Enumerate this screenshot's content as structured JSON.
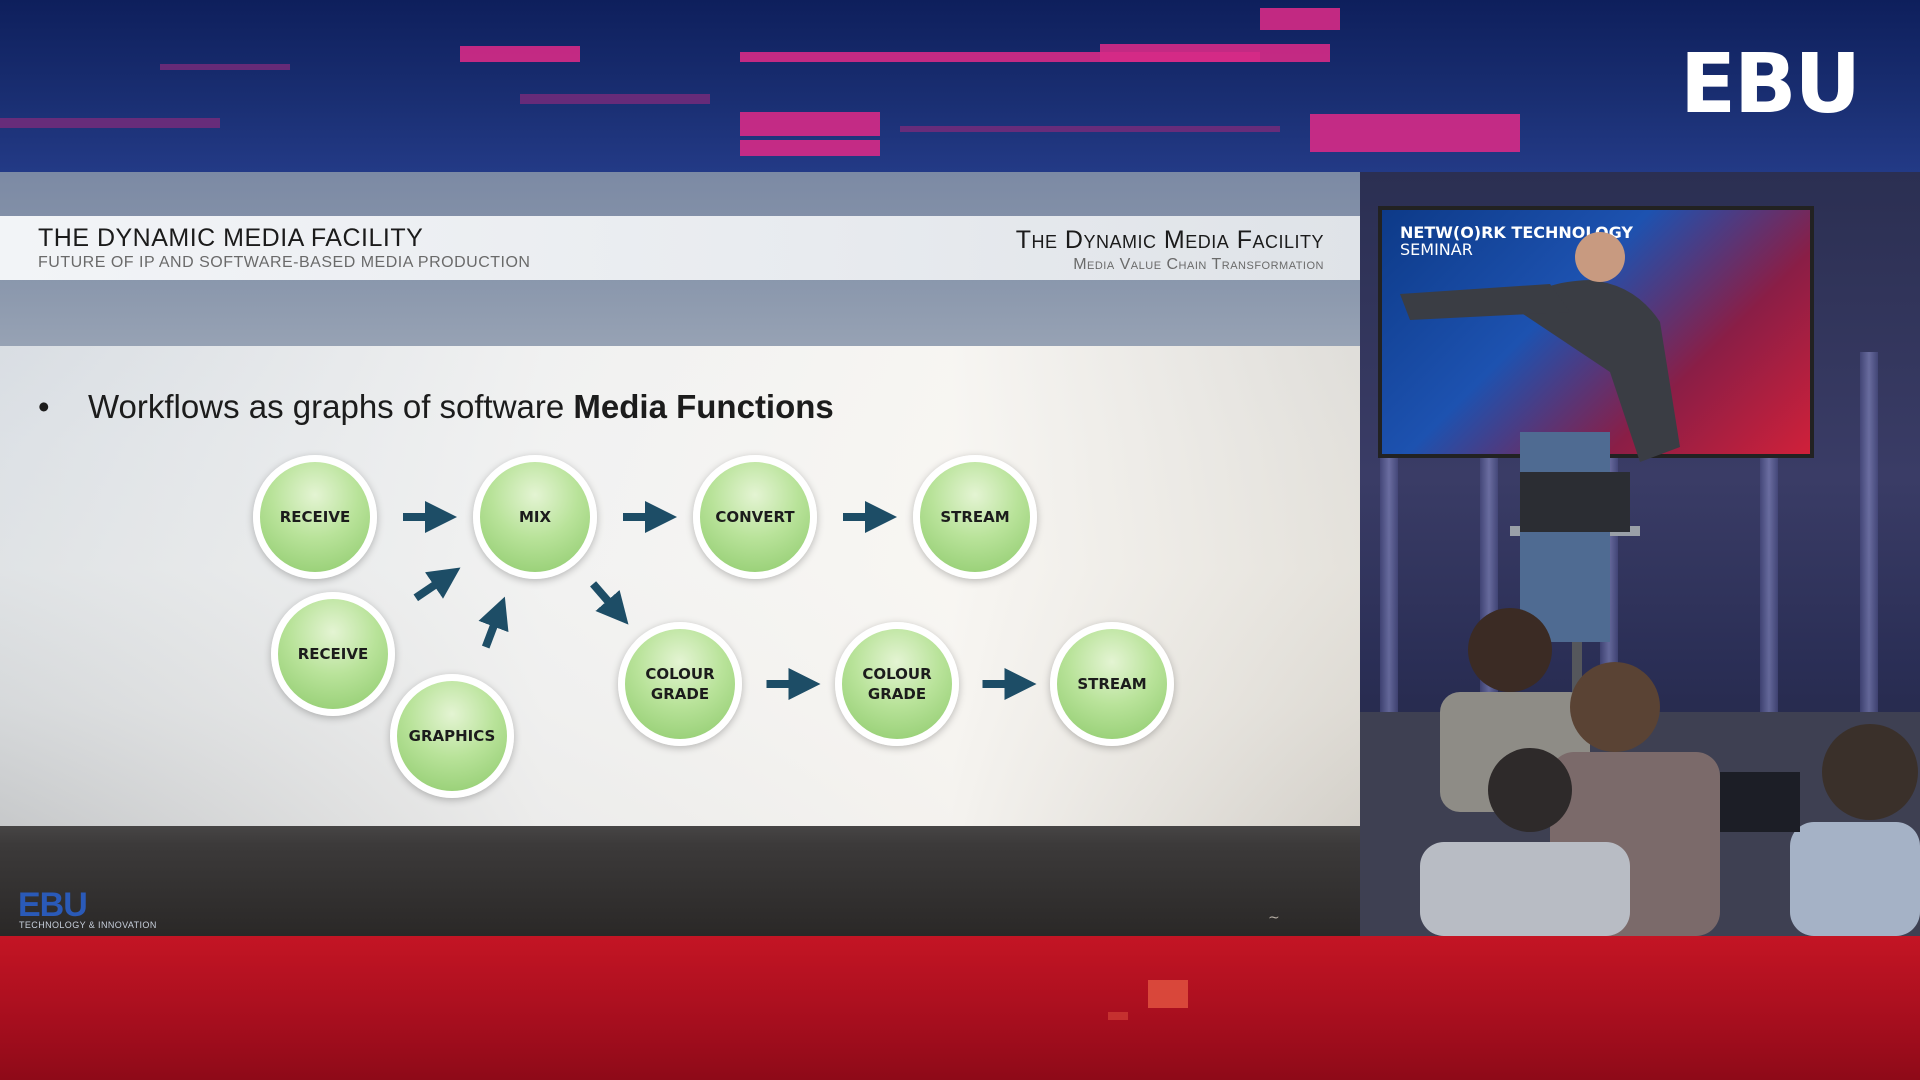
{
  "banner": {
    "logo": "EBU"
  },
  "slide": {
    "header": {
      "title": "THE DYNAMIC MEDIA FACILITY",
      "subtitle": "FUTURE OF IP AND SOFTWARE-BASED MEDIA PRODUCTION",
      "right_title": "The Dynamic Media Facility",
      "right_subtitle": "Media Value Chain Transformation"
    },
    "bullet": {
      "marker": "•",
      "text": "Workflows as graphs of software ",
      "bold": "Media Functions"
    },
    "diagram": {
      "nodes": [
        {
          "id": "receive1",
          "label": "RECEIVE"
        },
        {
          "id": "mix",
          "label": "MIX"
        },
        {
          "id": "convert",
          "label": "CONVERT"
        },
        {
          "id": "stream1",
          "label": "STREAM"
        },
        {
          "id": "receive2",
          "label": "RECEIVE"
        },
        {
          "id": "graphics",
          "label": "GRAPHICS"
        },
        {
          "id": "colour1",
          "label": "COLOUR\nGRADE"
        },
        {
          "id": "colour2",
          "label": "COLOUR\nGRADE"
        },
        {
          "id": "stream2",
          "label": "STREAM"
        }
      ],
      "edges": [
        [
          "receive1",
          "mix"
        ],
        [
          "mix",
          "convert"
        ],
        [
          "convert",
          "stream1"
        ],
        [
          "receive2",
          "mix"
        ],
        [
          "graphics",
          "mix"
        ],
        [
          "mix",
          "colour1"
        ],
        [
          "colour1",
          "colour2"
        ],
        [
          "colour2",
          "stream2"
        ]
      ],
      "node_color": "#9fd67e",
      "arrow_color": "#1d4d66"
    },
    "footer": {
      "logo": "EBU",
      "sub": "TECHNOLOGY & INNOVATION"
    }
  },
  "photo": {
    "screen_title": "NETW(O)RK TECHNOLOGY",
    "screen_sub": "SEMINAR"
  }
}
